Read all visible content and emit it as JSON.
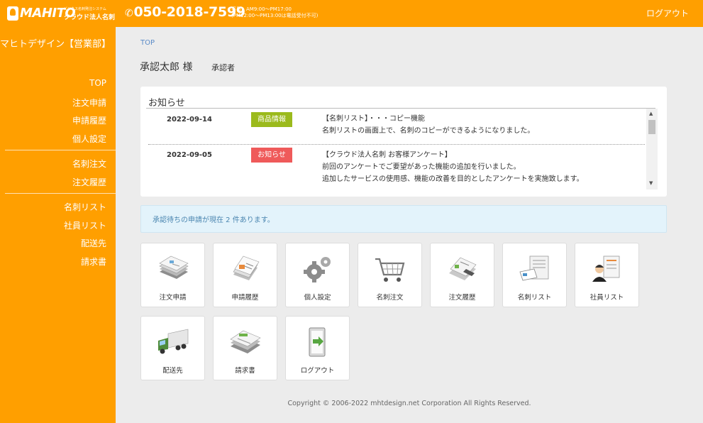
{
  "header": {
    "logo_text": "MAHITO",
    "logo_subtitle": "ビジネス名刺発注システム",
    "logo_service": "クラウド法人名刺",
    "phone": "050-2018-7599",
    "hours_line1": "平日：AM9:00〜PM17:00",
    "hours_line2": "(PM12:00〜PM13:00は電話受付不可)",
    "logout": "ログアウト"
  },
  "sidebar": {
    "company": "マヒトデザイン【営業部】",
    "items": [
      "TOP",
      "注文申請",
      "申請履歴",
      "個人設定",
      "名刺注文",
      "注文履歴",
      "名刺リスト",
      "社員リスト",
      "配送先",
      "請求書"
    ]
  },
  "main": {
    "breadcrumb": "TOP",
    "user_name": "承認太郎 様",
    "user_role": "承認者",
    "news": {
      "title": "お知らせ",
      "items": [
        {
          "date": "2022-09-14",
          "badge": "商品情報",
          "badge_color": "#9bba1c",
          "lines": [
            "【名刺リスト】・・・コピー機能",
            "名刺リストの画面上で、名刺のコピーができるようになりました。"
          ]
        },
        {
          "date": "2022-09-05",
          "badge": "お知らせ",
          "badge_color": "#ef5a5a",
          "lines": [
            "【クラウド法人名刺 お客様アンケート】",
            "前回のアンケートでご要望があった機能の追加を行いました。",
            "追加したサービスの使用感、機能の改善を目的としたアンケートを実施致します。"
          ]
        }
      ]
    },
    "notice": "承認待ちの申請が現在 2 件あります。",
    "tiles": [
      {
        "label": "注文申請",
        "icon": "order-request-icon"
      },
      {
        "label": "申請履歴",
        "icon": "request-history-icon"
      },
      {
        "label": "個人設定",
        "icon": "gear-icon"
      },
      {
        "label": "名刺注文",
        "icon": "cart-icon"
      },
      {
        "label": "注文履歴",
        "icon": "order-history-icon"
      },
      {
        "label": "名刺リスト",
        "icon": "card-list-icon"
      },
      {
        "label": "社員リスト",
        "icon": "employee-list-icon"
      },
      {
        "label": "配送先",
        "icon": "truck-icon"
      },
      {
        "label": "請求書",
        "icon": "invoice-icon"
      },
      {
        "label": "ログアウト",
        "icon": "logout-door-icon"
      }
    ],
    "copyright": "Copyright © 2006-2022 mhtdesign.net Corporation All Rights Reserved."
  },
  "colors": {
    "brand_orange": "#ff9f00",
    "link_blue": "#5b8cc8",
    "notice_bg": "#e3f3fb",
    "badge_green": "#9bba1c",
    "badge_red": "#ef5a5a"
  }
}
